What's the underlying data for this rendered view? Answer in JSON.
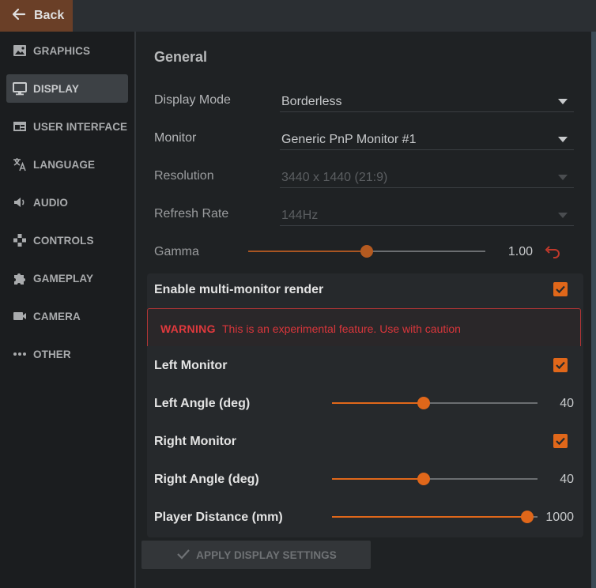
{
  "topbar": {
    "back_label": "Back"
  },
  "sidebar": {
    "items": [
      {
        "label": "GRAPHICS",
        "icon": "image-icon"
      },
      {
        "label": "DISPLAY",
        "icon": "monitor-icon",
        "active": true
      },
      {
        "label": "USER INTERFACE",
        "icon": "window-icon"
      },
      {
        "label": "LANGUAGE",
        "icon": "translate-icon"
      },
      {
        "label": "AUDIO",
        "icon": "speaker-icon"
      },
      {
        "label": "CONTROLS",
        "icon": "gamepad-icon"
      },
      {
        "label": "GAMEPLAY",
        "icon": "puzzle-icon"
      },
      {
        "label": "CAMERA",
        "icon": "camera-icon"
      },
      {
        "label": "OTHER",
        "icon": "more-icon"
      }
    ]
  },
  "general": {
    "title": "General",
    "display_mode": {
      "label": "Display Mode",
      "value": "Borderless"
    },
    "monitor": {
      "label": "Monitor",
      "value": "Generic PnP Monitor #1"
    },
    "resolution": {
      "label": "Resolution",
      "value": "3440 x 1440 (21:9)",
      "disabled": true
    },
    "refresh_rate": {
      "label": "Refresh Rate",
      "value": "144Hz",
      "disabled": true
    },
    "gamma": {
      "label": "Gamma",
      "value": "1.00",
      "fraction": 0.5
    }
  },
  "multi_monitor": {
    "enable_label": "Enable multi-monitor render",
    "enabled": true,
    "warning_title": "WARNING",
    "warning_text": "This is an experimental feature. Use with caution",
    "left_monitor": {
      "label": "Left Monitor",
      "checked": true
    },
    "left_angle": {
      "label": "Left Angle (deg)",
      "value": "40",
      "fraction": 0.445
    },
    "right_monitor": {
      "label": "Right Monitor",
      "checked": true
    },
    "right_angle": {
      "label": "Right Angle (deg)",
      "value": "40",
      "fraction": 0.445
    },
    "player_distance": {
      "label": "Player Distance (mm)",
      "value": "1000",
      "fraction": 0.95
    }
  },
  "apply_label": "APPLY DISPLAY SETTINGS",
  "colors": {
    "accent": "#e0671a",
    "warning": "#e0393d",
    "back_button": "#6a3f27"
  }
}
